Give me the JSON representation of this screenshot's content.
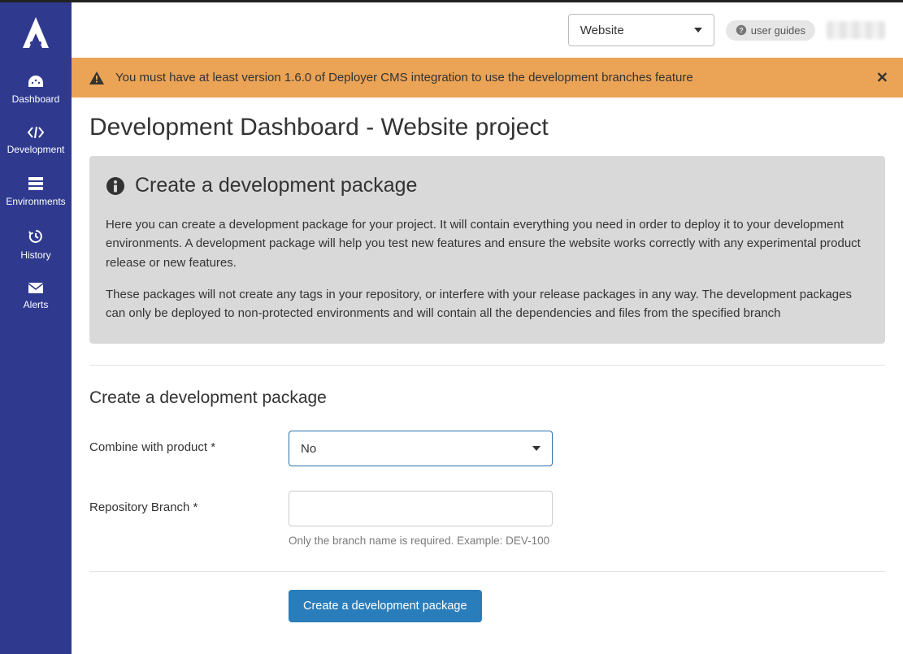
{
  "sidebar": {
    "items": [
      {
        "label": "Dashboard"
      },
      {
        "label": "Development"
      },
      {
        "label": "Environments"
      },
      {
        "label": "History"
      },
      {
        "label": "Alerts"
      }
    ]
  },
  "topbar": {
    "project_select": {
      "value": "Website"
    },
    "guides_label": "user guides"
  },
  "alert": {
    "text": "You must have at least version 1.6.0 of Deployer CMS integration to use the development branches feature"
  },
  "page": {
    "title": "Development Dashboard - Website project"
  },
  "info": {
    "heading": "Create a development package",
    "para1": "Here you can create a development package for your project. It will contain everything you need in order to deploy it to your development environments. A development package will help you test new features and ensure the website works correctly with any experimental product release or new features.",
    "para2": "These packages will not create any tags in your repository, or interfere with your release packages in any way. The development packages can only be deployed to non-protected environments and will contain all the dependencies and files from the specified branch"
  },
  "form": {
    "section_title": "Create a development package",
    "combine_label": "Combine with product *",
    "combine_value": "No",
    "branch_label": "Repository Branch *",
    "branch_value": "",
    "branch_helper": "Only the branch name is required. Example: DEV-100",
    "submit_label": "Create a development package"
  }
}
